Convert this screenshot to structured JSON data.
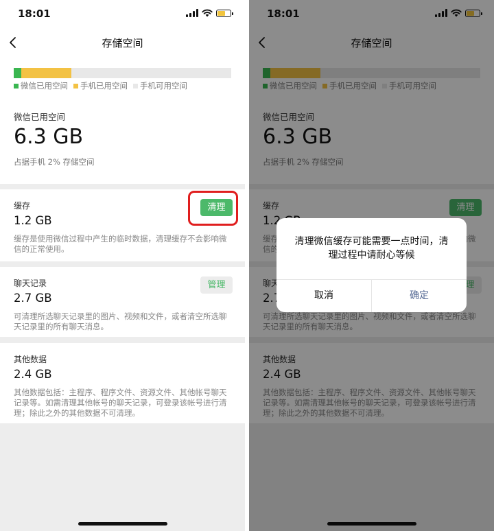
{
  "status": {
    "time": "18:01"
  },
  "nav": {
    "title": "存储空间"
  },
  "usage": {
    "fractions": [
      0.036,
      0.228,
      0.736
    ],
    "colors": [
      "#3ab650",
      "#f3c244",
      "#e8e8e8"
    ],
    "legend": [
      "微信已用空间",
      "手机已用空间",
      "手机可用空间"
    ]
  },
  "summary": {
    "label": "微信已用空间",
    "value": "6.3 GB",
    "note": "占据手机 2% 存储空间"
  },
  "cache": {
    "label": "缓存",
    "value": "1.2 GB",
    "desc": "缓存是使用微信过程中产生的临时数据，清理缓存不会影响微信的正常使用。",
    "button": "清理"
  },
  "chat": {
    "label": "聊天记录",
    "value": "2.7 GB",
    "desc": "可清理所选聊天记录里的图片、视频和文件，或者清空所选聊天记录里的所有聊天消息。",
    "button": "管理"
  },
  "other": {
    "label": "其他数据",
    "value": "2.4 GB",
    "desc": "其他数据包括：主程序、程序文件、资源文件、其他帐号聊天记录等。如需清理其他帐号的聊天记录，可登录该帐号进行清理；除此之外的其他数据不可清理。"
  },
  "dialog": {
    "message": "清理微信缓存可能需要一点时间，清理过程中请耐心等候",
    "cancel": "取消",
    "confirm": "确定"
  }
}
